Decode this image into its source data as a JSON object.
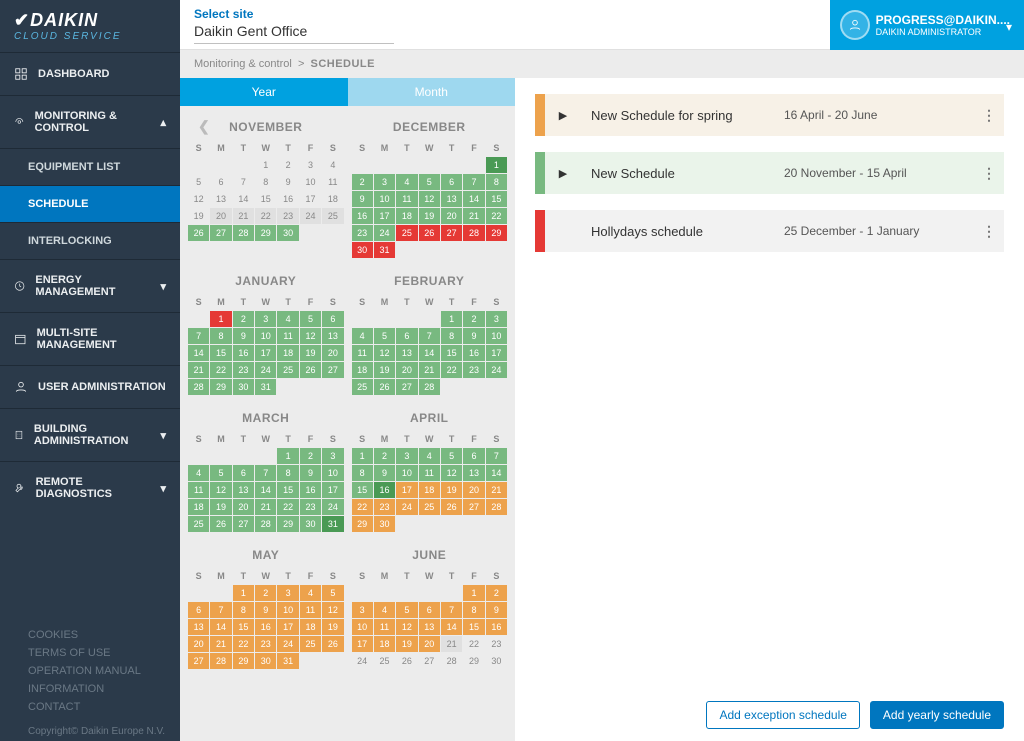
{
  "brand": {
    "name": "DAIKIN",
    "service": "CLOUD SERVICE"
  },
  "site_selector": {
    "label": "Select site",
    "value": "Daikin Gent Office"
  },
  "user": {
    "name": "PROGRESS@DAIKIN....",
    "role": "DAIKIN ADMINISTRATOR"
  },
  "breadcrumb": {
    "parent": "Monitoring & control",
    "sep": ">",
    "current": "SCHEDULE"
  },
  "nav": {
    "dashboard": "DASHBOARD",
    "monitoring": "MONITORING & CONTROL",
    "equipment": "EQUIPMENT LIST",
    "schedule": "SCHEDULE",
    "interlocking": "INTERLOCKING",
    "energy": "ENERGY MANAGEMENT",
    "multisite": "MULTI-SITE MANAGEMENT",
    "useradmin": "USER ADMINISTRATION",
    "building": "BUILDING ADMINISTRATION",
    "remote": "REMOTE DIAGNOSTICS"
  },
  "footer": {
    "cookies": "COOKIES",
    "terms": "TERMS OF USE",
    "manual": "OPERATION MANUAL",
    "info": "INFORMATION",
    "contact": "CONTACT",
    "copyright": "Copyright© Daikin Europe N.V."
  },
  "tabs": {
    "year": "Year",
    "month": "Month"
  },
  "dow": [
    "S",
    "M",
    "T",
    "W",
    "T",
    "F",
    "S"
  ],
  "months": [
    {
      "name": "NOVEMBER",
      "firstDow": 3,
      "days": 30,
      "hasPrevArrow": true,
      "colors": {
        "green": [
          [
            26,
            30
          ]
        ],
        "gray": [
          [
            20,
            25
          ]
        ]
      }
    },
    {
      "name": "DECEMBER",
      "firstDow": 6,
      "days": 31,
      "colors": {
        "green": [
          [
            2,
            24
          ]
        ],
        "red": [
          [
            25,
            31
          ]
        ],
        "dkgreen": [
          [
            1,
            1
          ]
        ]
      }
    },
    {
      "name": "JANUARY",
      "firstDow": 1,
      "days": 31,
      "colors": {
        "green": [
          [
            2,
            31
          ]
        ],
        "red": [
          [
            1,
            1
          ]
        ]
      }
    },
    {
      "name": "FEBRUARY",
      "firstDow": 4,
      "days": 28,
      "colors": {
        "green": [
          [
            1,
            28
          ]
        ]
      }
    },
    {
      "name": "MARCH",
      "firstDow": 4,
      "days": 31,
      "colors": {
        "green": [
          [
            1,
            30
          ]
        ],
        "dkgreen": [
          [
            31,
            31
          ]
        ]
      }
    },
    {
      "name": "APRIL",
      "firstDow": 0,
      "days": 30,
      "colors": {
        "green": [
          [
            1,
            15
          ]
        ],
        "orange": [
          [
            17,
            30
          ]
        ],
        "dkgreen": [
          [
            16,
            16
          ]
        ]
      }
    },
    {
      "name": "MAY",
      "firstDow": 2,
      "days": 31,
      "colors": {
        "orange": [
          [
            1,
            31
          ]
        ]
      }
    },
    {
      "name": "JUNE",
      "firstDow": 5,
      "days": 30,
      "colors": {
        "orange": [
          [
            1,
            20
          ]
        ],
        "gray": [
          [
            21,
            21
          ]
        ]
      }
    }
  ],
  "schedules": [
    {
      "color": "orange",
      "name": "New Schedule for spring",
      "range": "16 April - 20 June",
      "expandable": true
    },
    {
      "color": "green",
      "name": "New Schedule",
      "range": "20 November - 15 April",
      "expandable": true
    },
    {
      "color": "red",
      "name": "Hollydays schedule",
      "range": "25 December - 1 January",
      "expandable": false
    }
  ],
  "actions": {
    "exception": "Add exception schedule",
    "yearly": "Add yearly schedule"
  }
}
